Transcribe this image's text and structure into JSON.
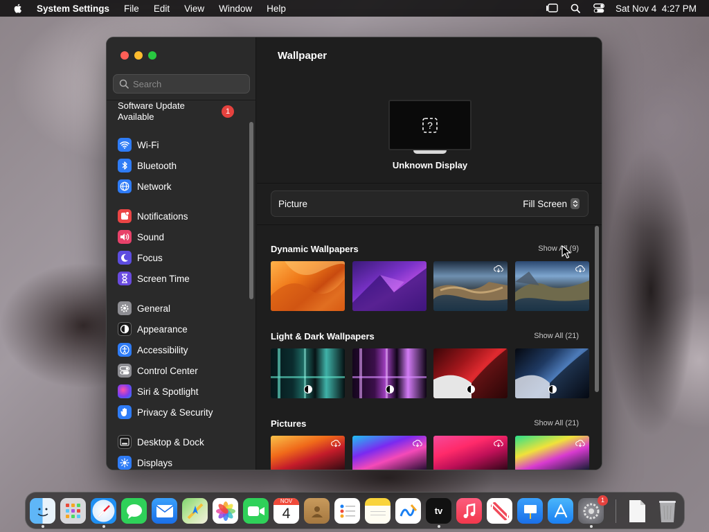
{
  "menubar": {
    "app_name": "System Settings",
    "items": [
      "File",
      "Edit",
      "View",
      "Window",
      "Help"
    ],
    "clock": "Sat Nov 4  4:27 PM"
  },
  "sidebar": {
    "search_placeholder": "Search",
    "software_update": {
      "line1": "Software Update",
      "line2": "Available",
      "badge": "1"
    },
    "items": [
      {
        "label": "Wi-Fi",
        "icon": "wifi-icon",
        "color": "#2f7cf6"
      },
      {
        "label": "Bluetooth",
        "icon": "bluetooth-icon",
        "color": "#2f7cf6"
      },
      {
        "label": "Network",
        "icon": "globe-icon",
        "color": "#2f7cf6"
      },
      {
        "label": "Notifications",
        "icon": "bell-icon",
        "color": "#eb4545"
      },
      {
        "label": "Sound",
        "icon": "speaker-icon",
        "color": "#e8426a"
      },
      {
        "label": "Focus",
        "icon": "moon-icon",
        "color": "#5d4de0"
      },
      {
        "label": "Screen Time",
        "icon": "hourglass-icon",
        "color": "#6a4be0"
      },
      {
        "label": "General",
        "icon": "gear-icon",
        "color": "#8e8e93"
      },
      {
        "label": "Appearance",
        "icon": "appearance-icon",
        "color": "#1a1a1a"
      },
      {
        "label": "Accessibility",
        "icon": "accessibility-icon",
        "color": "#2f7cf6"
      },
      {
        "label": "Control Center",
        "icon": "control-center-icon",
        "color": "#8e8e93"
      },
      {
        "label": "Siri & Spotlight",
        "icon": "siri-icon",
        "color": "#c43bd1"
      },
      {
        "label": "Privacy & Security",
        "icon": "hand-icon",
        "color": "#2f7cf6"
      },
      {
        "label": "Desktop & Dock",
        "icon": "dock-icon",
        "color": "#1a1a1a"
      },
      {
        "label": "Displays",
        "icon": "sun-icon",
        "color": "#2f7cf6"
      }
    ]
  },
  "main": {
    "title": "Wallpaper",
    "display_name": "Unknown Display",
    "picture_label": "Picture",
    "picture_value": "Fill Screen",
    "sections": [
      {
        "title": "Dynamic Wallpapers",
        "show_all": "Show All (9)"
      },
      {
        "title": "Light & Dark Wallpapers",
        "show_all": "Show All (21)"
      },
      {
        "title": "Pictures",
        "show_all": "Show All (21)"
      }
    ]
  },
  "dock": {
    "apps": [
      "Finder",
      "Launchpad",
      "Safari",
      "Messages",
      "Mail",
      "Maps",
      "Photos",
      "FaceTime",
      "Calendar",
      "Contacts",
      "Reminders",
      "Notes",
      "Freeform",
      "TV",
      "Music",
      "News",
      "Keynote",
      "App Store",
      "System Settings",
      "Documents",
      "Trash"
    ],
    "calendar_month": "NOV",
    "calendar_day": "4",
    "tv_label": "tv",
    "settings_badge": "1"
  }
}
